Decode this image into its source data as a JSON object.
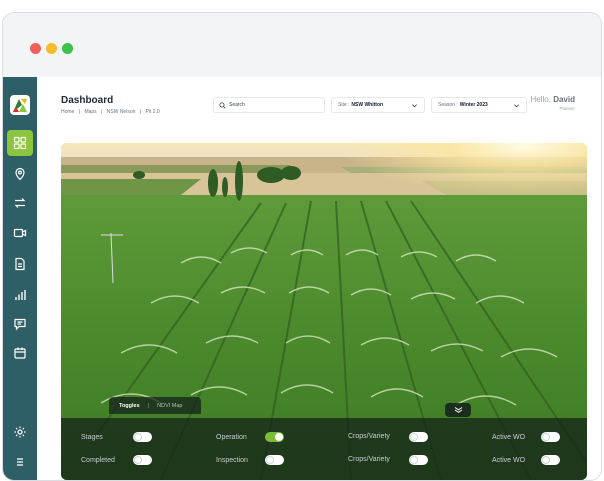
{
  "window": {
    "controls": [
      "close",
      "minimize",
      "maximize"
    ]
  },
  "sidebar": {
    "logo": "app-logo",
    "items": [
      {
        "icon": "grid-icon",
        "active": true
      },
      {
        "icon": "map-pin-icon",
        "active": false
      },
      {
        "icon": "transfer-icon",
        "active": false
      },
      {
        "icon": "video-icon",
        "active": false
      },
      {
        "icon": "document-icon",
        "active": false
      },
      {
        "icon": "bar-chart-icon",
        "active": false
      },
      {
        "icon": "message-icon",
        "active": false
      },
      {
        "icon": "calendar-icon",
        "active": false
      }
    ],
    "bottom_items": [
      {
        "icon": "gear-icon"
      },
      {
        "icon": "menu-icon"
      }
    ]
  },
  "header": {
    "title": "Dashboard",
    "breadcrumb": [
      "Home",
      "|",
      "Maps",
      "|",
      "NSW Nelson",
      "|",
      "Pit 2.0"
    ],
    "search_placeholder": "Search",
    "site_label": "Site :",
    "site_value": "NSW Whitton",
    "season_label": "Season :",
    "season_value": "Winter 2023",
    "greeting": "Hello,",
    "user_name": "David",
    "user_role": "Planner"
  },
  "panel": {
    "tabs": [
      "Toggles",
      "|",
      "NDVI Map"
    ],
    "toggles": [
      {
        "label": "Stages",
        "on": false
      },
      {
        "label": "Completed",
        "on": false
      },
      {
        "label": "Operation",
        "on": true
      },
      {
        "label": "Inspection",
        "on": false
      },
      {
        "label": "Crops/Variety",
        "on": false
      },
      {
        "label": "Crops/Variety",
        "on": false
      },
      {
        "label": "Active WO",
        "on": false
      },
      {
        "label": "Active WO",
        "on": false
      }
    ]
  },
  "colors": {
    "sidebar": "#2f5f66",
    "accent": "#8cc63f",
    "toggle_on": "#7dbb3a"
  }
}
